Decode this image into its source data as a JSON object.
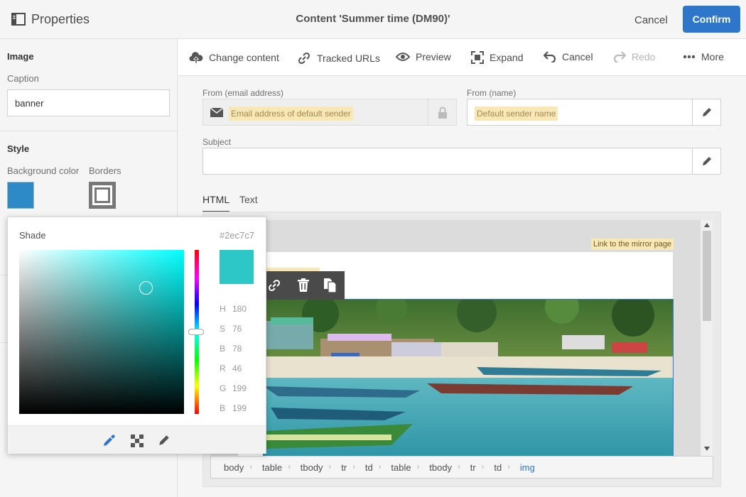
{
  "header": {
    "panel_title": "Properties",
    "doc_title": "Content 'Summer time (DM90)'",
    "cancel_label": "Cancel",
    "confirm_label": "Confirm"
  },
  "sidebar": {
    "image_section": "Image",
    "caption_label": "Caption",
    "caption_value": "banner",
    "style_section": "Style",
    "bg_color_label": "Background color",
    "borders_label": "Borders",
    "bg_color": "#2d8ac6"
  },
  "color_picker": {
    "title": "Shade",
    "hex": "#2ec7c7",
    "h_label": "H",
    "h_value": "180",
    "s_label": "S",
    "s_value": "76",
    "b_label": "B",
    "b_value": "78",
    "r_label": "R",
    "r_value": "46",
    "g_label": "G",
    "g_value": "199",
    "b2_label": "B",
    "b2_value": "199"
  },
  "toolbar": {
    "change_content": "Change content",
    "tracked_urls": "Tracked URLs",
    "preview": "Preview",
    "expand": "Expand",
    "cancel": "Cancel",
    "redo": "Redo",
    "more": "More"
  },
  "form": {
    "from_email_label": "From (email address)",
    "from_email_value": "Email address of default sender",
    "from_name_label": "From (name)",
    "from_name_value": "Default sender name",
    "subject_label": "Subject",
    "subject_value": ""
  },
  "tabs": {
    "html": "HTML",
    "text": "Text"
  },
  "editor": {
    "mirror_link": "Link to the mirror page",
    "breadcrumb": [
      "body",
      "table",
      "tbody",
      "tr",
      "td",
      "table",
      "tbody",
      "tr",
      "td",
      "img"
    ]
  },
  "colors": {
    "accent": "#2d76c9",
    "shade": "#2ec7c7",
    "highlight": "#f9e7b5"
  }
}
